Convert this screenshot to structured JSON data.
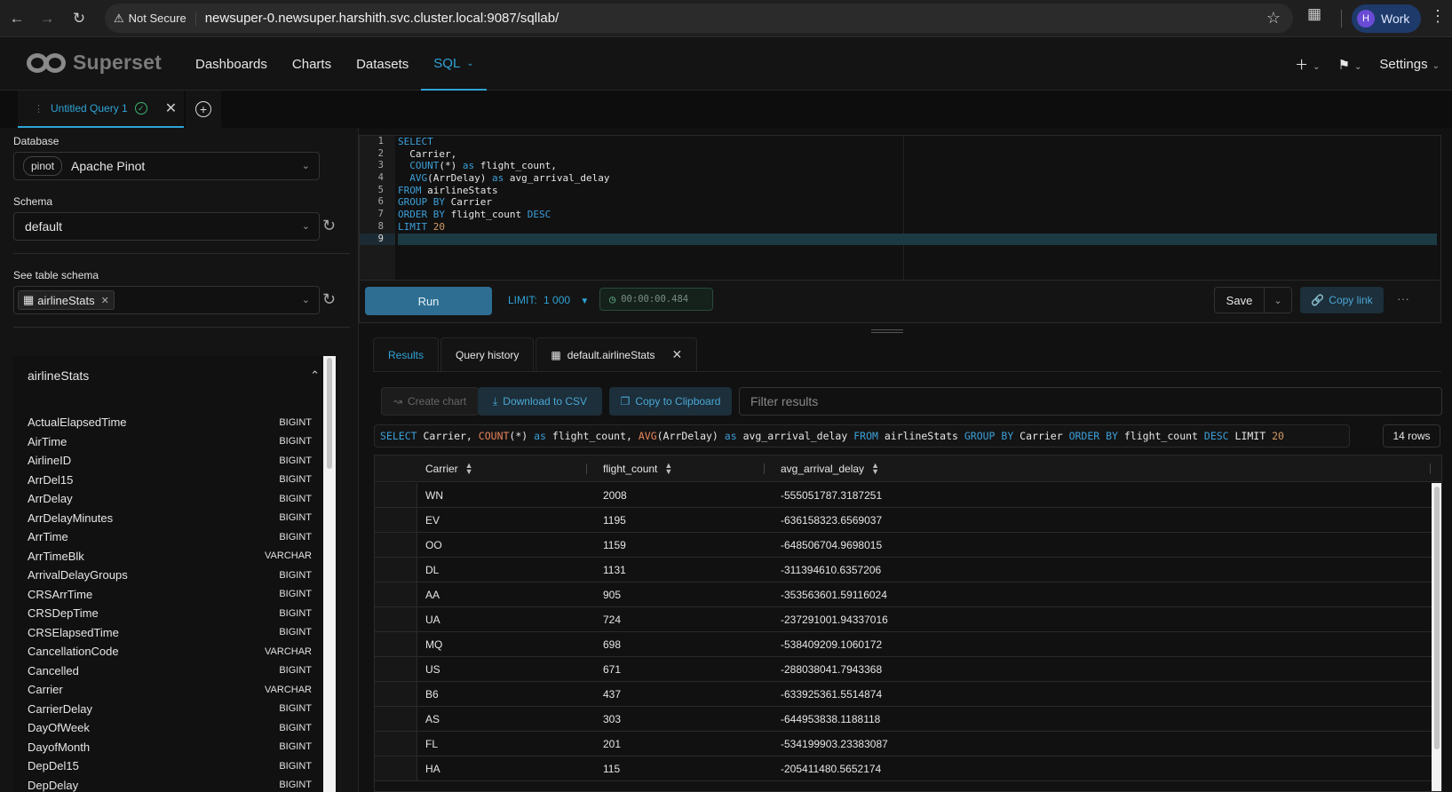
{
  "browser": {
    "security_label": "Not Secure",
    "url": "newsuper-0.newsuper.harshith.svc.cluster.local:9087/sqllab/",
    "profile_initial": "H",
    "profile_name": "Work"
  },
  "app": {
    "logo_text": "Superset",
    "menu": [
      "Dashboards",
      "Charts",
      "Datasets",
      "SQL"
    ],
    "active_menu": "SQL",
    "settings_label": "Settings"
  },
  "query_tab": {
    "title": "Untitled Query 1"
  },
  "sidebar": {
    "database_label": "Database",
    "database_tag": "pinot",
    "database_value": "Apache Pinot",
    "schema_label": "Schema",
    "schema_value": "default",
    "table_schema_label": "See table schema",
    "table_chip": "airlineStats",
    "panel_title": "airlineStats",
    "columns": [
      {
        "name": "ActualElapsedTime",
        "type": "BIGINT"
      },
      {
        "name": "AirTime",
        "type": "BIGINT"
      },
      {
        "name": "AirlineID",
        "type": "BIGINT"
      },
      {
        "name": "ArrDel15",
        "type": "BIGINT"
      },
      {
        "name": "ArrDelay",
        "type": "BIGINT"
      },
      {
        "name": "ArrDelayMinutes",
        "type": "BIGINT"
      },
      {
        "name": "ArrTime",
        "type": "BIGINT"
      },
      {
        "name": "ArrTimeBlk",
        "type": "VARCHAR"
      },
      {
        "name": "ArrivalDelayGroups",
        "type": "BIGINT"
      },
      {
        "name": "CRSArrTime",
        "type": "BIGINT"
      },
      {
        "name": "CRSDepTime",
        "type": "BIGINT"
      },
      {
        "name": "CRSElapsedTime",
        "type": "BIGINT"
      },
      {
        "name": "CancellationCode",
        "type": "VARCHAR"
      },
      {
        "name": "Cancelled",
        "type": "BIGINT"
      },
      {
        "name": "Carrier",
        "type": "VARCHAR"
      },
      {
        "name": "CarrierDelay",
        "type": "BIGINT"
      },
      {
        "name": "DayOfWeek",
        "type": "BIGINT"
      },
      {
        "name": "DayofMonth",
        "type": "BIGINT"
      },
      {
        "name": "DepDel15",
        "type": "BIGINT"
      },
      {
        "name": "DepDelay",
        "type": "BIGINT"
      }
    ]
  },
  "editor": {
    "line_numbers": [
      "1",
      "2",
      "3",
      "4",
      "5",
      "6",
      "7",
      "8",
      "9"
    ],
    "lines": [
      [
        {
          "t": "SELECT",
          "k": "kw"
        }
      ],
      [
        {
          "t": "  Carrier,",
          "k": ""
        }
      ],
      [
        {
          "t": "  ",
          "k": ""
        },
        {
          "t": "COUNT",
          "k": "kw"
        },
        {
          "t": "(*) ",
          "k": ""
        },
        {
          "t": "as",
          "k": "kw"
        },
        {
          "t": " flight_count,",
          "k": ""
        }
      ],
      [
        {
          "t": "  ",
          "k": ""
        },
        {
          "t": "AVG",
          "k": "kw"
        },
        {
          "t": "(ArrDelay) ",
          "k": ""
        },
        {
          "t": "as",
          "k": "kw"
        },
        {
          "t": " avg_arrival_delay",
          "k": ""
        }
      ],
      [
        {
          "t": "FROM",
          "k": "kw"
        },
        {
          "t": " airlineStats",
          "k": ""
        }
      ],
      [
        {
          "t": "GROUP BY",
          "k": "kw"
        },
        {
          "t": " Carrier",
          "k": ""
        }
      ],
      [
        {
          "t": "ORDER BY",
          "k": "kw"
        },
        {
          "t": " flight_count ",
          "k": ""
        },
        {
          "t": "DESC",
          "k": "kw"
        }
      ],
      [
        {
          "t": "LIMIT",
          "k": "kw"
        },
        {
          "t": " ",
          "k": ""
        },
        {
          "t": "20",
          "k": "num"
        }
      ],
      [
        {
          "t": "",
          "k": ""
        }
      ]
    ]
  },
  "toolbar": {
    "run_label": "Run",
    "limit_label": "LIMIT:",
    "limit_value": "1 000",
    "timer": "00:00:00.484",
    "save_label": "Save",
    "copy_link_label": "Copy link",
    "more": "···"
  },
  "results": {
    "tabs": [
      "Results",
      "Query history"
    ],
    "table_tab": "default.airlineStats",
    "create_chart": "Create chart",
    "download_csv": "Download to CSV",
    "copy_clipboard": "Copy to Clipboard",
    "filter_placeholder": "Filter results",
    "rows_badge": "14 rows",
    "executed_sql": [
      {
        "t": "SELECT",
        "k": "kw"
      },
      {
        "t": " Carrier, ",
        "k": ""
      },
      {
        "t": "COUNT",
        "k": "fn"
      },
      {
        "t": "(*) ",
        "k": ""
      },
      {
        "t": "as",
        "k": "kw"
      },
      {
        "t": " flight_count, ",
        "k": ""
      },
      {
        "t": "AVG",
        "k": "fn"
      },
      {
        "t": "(ArrDelay) ",
        "k": ""
      },
      {
        "t": "as",
        "k": "kw"
      },
      {
        "t": " avg_arrival_delay ",
        "k": ""
      },
      {
        "t": "FROM",
        "k": "kw"
      },
      {
        "t": " airlineStats ",
        "k": ""
      },
      {
        "t": "GROUP BY",
        "k": "kw"
      },
      {
        "t": " Carrier ",
        "k": ""
      },
      {
        "t": "ORDER BY",
        "k": "kw"
      },
      {
        "t": " flight_count ",
        "k": ""
      },
      {
        "t": "DESC",
        "k": "kw"
      },
      {
        "t": " LIMIT ",
        "k": ""
      },
      {
        "t": "20",
        "k": "num"
      }
    ],
    "columns": [
      "Carrier",
      "flight_count",
      "avg_arrival_delay"
    ],
    "rows": [
      [
        "WN",
        "2008",
        "-555051787.3187251"
      ],
      [
        "EV",
        "1195",
        "-636158323.6569037"
      ],
      [
        "OO",
        "1159",
        "-648506704.9698015"
      ],
      [
        "DL",
        "1131",
        "-311394610.6357206"
      ],
      [
        "AA",
        "905",
        "-353563601.59116024"
      ],
      [
        "UA",
        "724",
        "-237291001.94337016"
      ],
      [
        "MQ",
        "698",
        "-538409209.1060172"
      ],
      [
        "US",
        "671",
        "-288038041.7943368"
      ],
      [
        "B6",
        "437",
        "-633925361.5514874"
      ],
      [
        "AS",
        "303",
        "-644953838.1188118"
      ],
      [
        "FL",
        "201",
        "-534199903.23383087"
      ],
      [
        "HA",
        "115",
        "-205411480.5652174"
      ]
    ]
  }
}
